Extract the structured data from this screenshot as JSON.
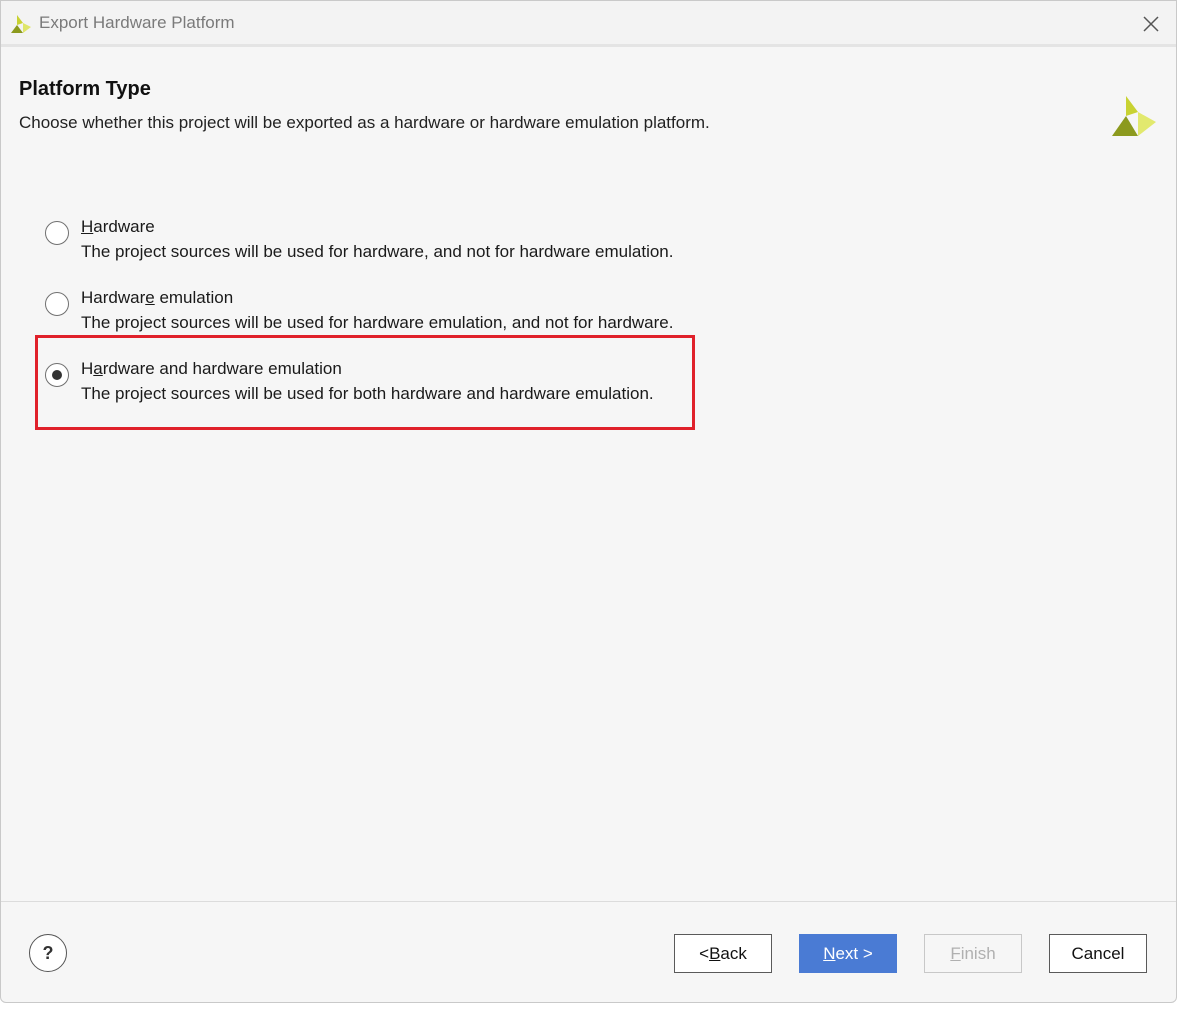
{
  "window": {
    "title": "Export Hardware Platform"
  },
  "header": {
    "title": "Platform Type",
    "subtitle": "Choose whether this project will be exported as a hardware or hardware emulation platform."
  },
  "options": [
    {
      "label_pre": "",
      "label_key": "H",
      "label_post": "ardware",
      "description": "The project sources will be used for hardware, and not for hardware emulation.",
      "selected": false
    },
    {
      "label_pre": "Hardwar",
      "label_key": "e",
      "label_post": " emulation",
      "description": "The project sources will be used for hardware emulation, and not for hardware.",
      "selected": false
    },
    {
      "label_pre": "H",
      "label_key": "a",
      "label_post": "rdware and hardware emulation",
      "description": "The project sources will be used for both hardware and hardware emulation.",
      "selected": true
    }
  ],
  "footer": {
    "help_label": "?",
    "back_pre": "< ",
    "back_key": "B",
    "back_post": "ack",
    "next_key": "N",
    "next_post": "ext >",
    "finish_key": "F",
    "finish_post": "inish",
    "cancel_label": "Cancel"
  },
  "colors": {
    "highlight": "#e0212b",
    "primary_button": "#4a7bd4",
    "logo_dark": "#8c9a1e",
    "logo_light": "#d8e03c"
  }
}
